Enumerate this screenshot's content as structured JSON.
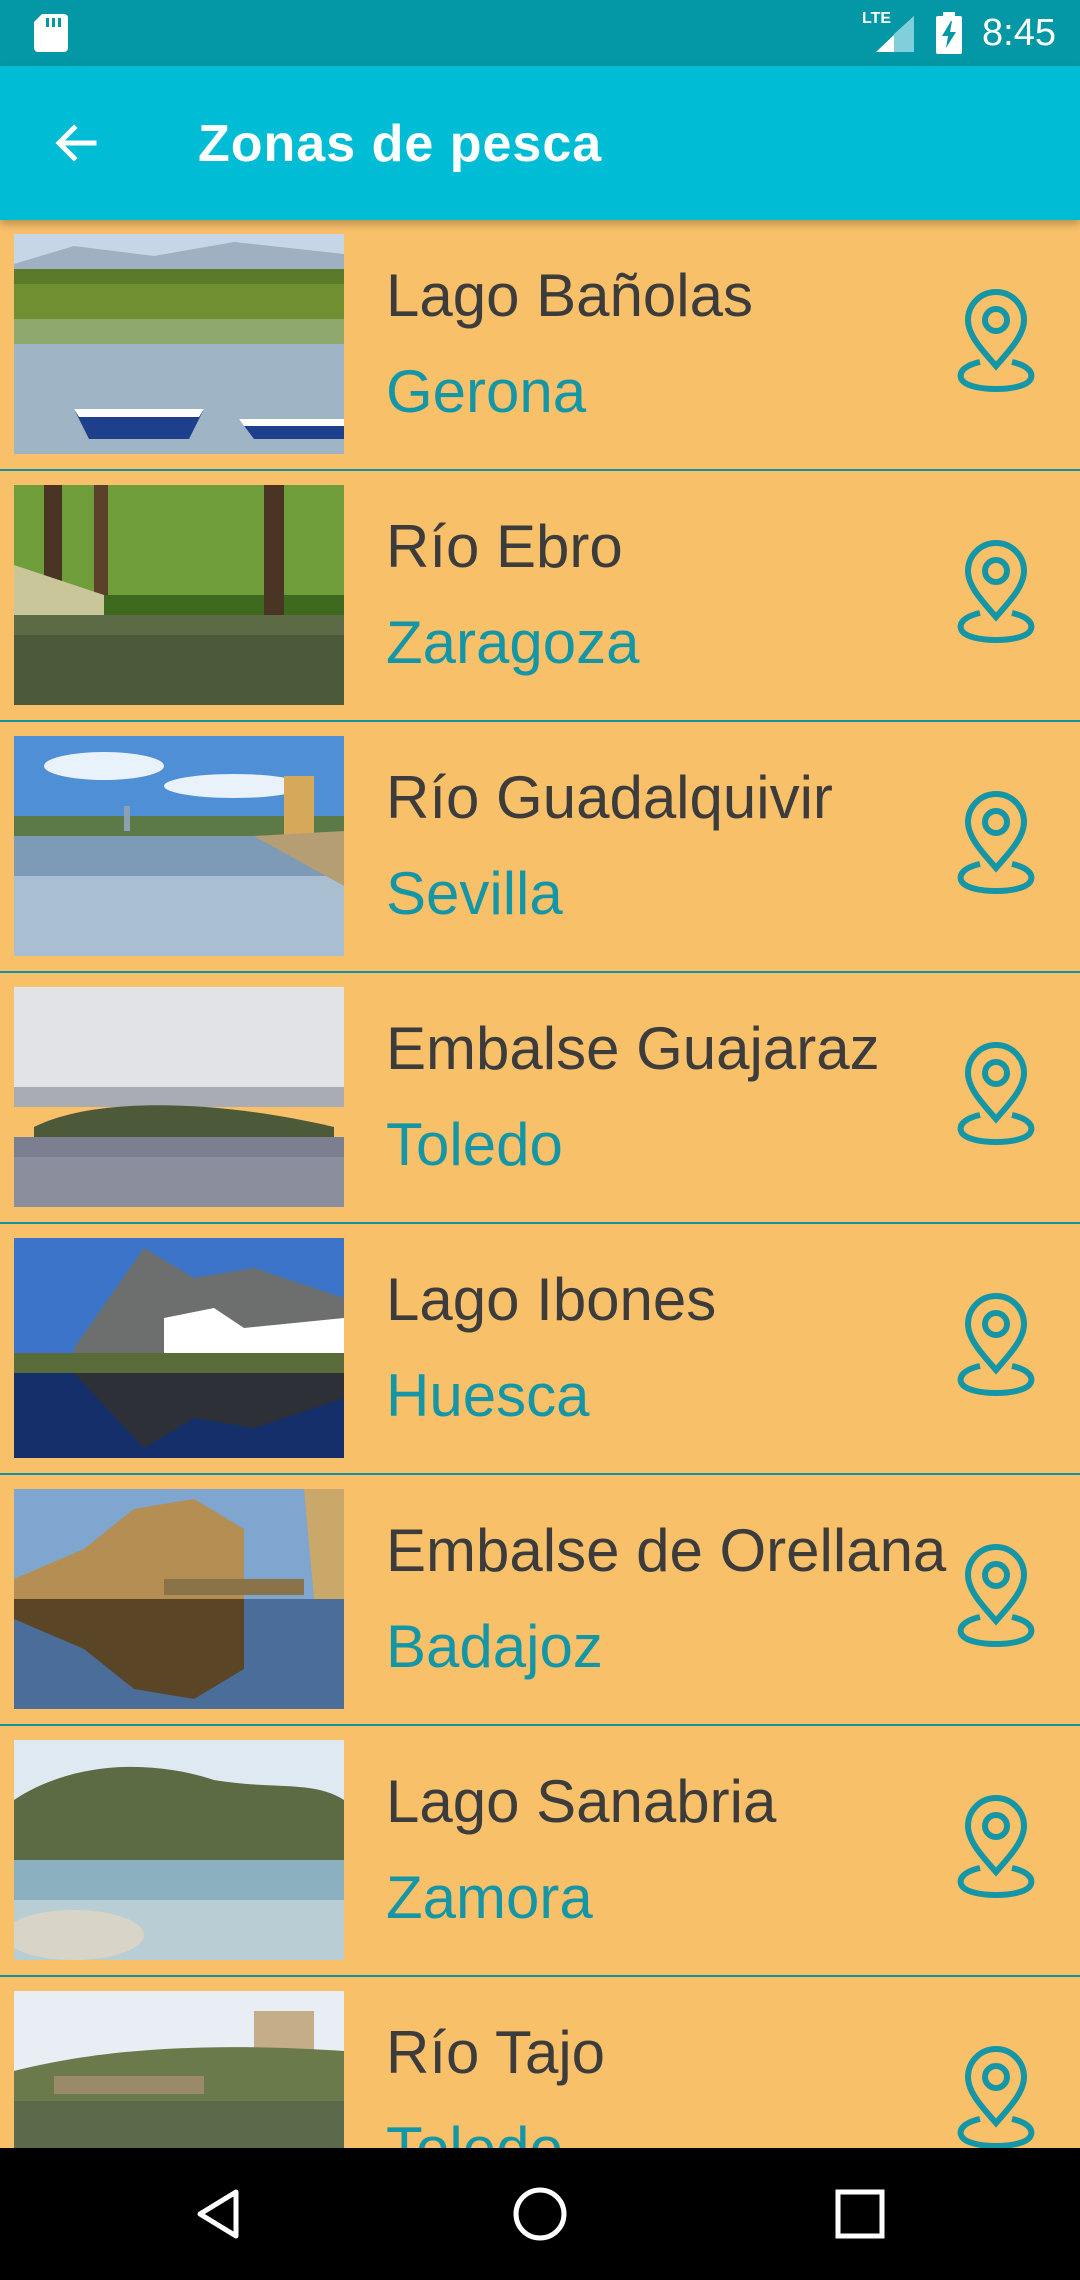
{
  "status_bar": {
    "time": "8:45",
    "network_label": "LTE",
    "icons": [
      "sd-card-icon",
      "lte-signal-icon",
      "battery-charging-icon"
    ]
  },
  "app_bar": {
    "title": "Zonas de pesca",
    "back_icon": "arrow-back-icon"
  },
  "colors": {
    "status_bar": "#0497A6",
    "app_bar": "#00BCD4",
    "list_background": "#F8C069",
    "accent": "#1596A6",
    "primary_text": "#3C3C3C",
    "nav_bar": "#000000"
  },
  "zones": [
    {
      "name": "Lago Bañolas",
      "region": "Gerona",
      "icon": "location-pin-icon"
    },
    {
      "name": "Río Ebro",
      "region": "Zaragoza",
      "icon": "location-pin-icon"
    },
    {
      "name": "Río Guadalquivir",
      "region": "Sevilla",
      "icon": "location-pin-icon"
    },
    {
      "name": "Embalse Guajaraz",
      "region": "Toledo",
      "icon": "location-pin-icon"
    },
    {
      "name": "Lago Ibones",
      "region": "Huesca",
      "icon": "location-pin-icon"
    },
    {
      "name": "Embalse de Orellana",
      "region": "Badajoz",
      "icon": "location-pin-icon"
    },
    {
      "name": "Lago Sanabria",
      "region": "Zamora",
      "icon": "location-pin-icon"
    },
    {
      "name": "Río Tajo",
      "region": "Toledo",
      "icon": "location-pin-icon"
    }
  ],
  "nav_bar": {
    "icons": [
      "nav-back-icon",
      "nav-home-icon",
      "nav-recents-icon"
    ]
  }
}
